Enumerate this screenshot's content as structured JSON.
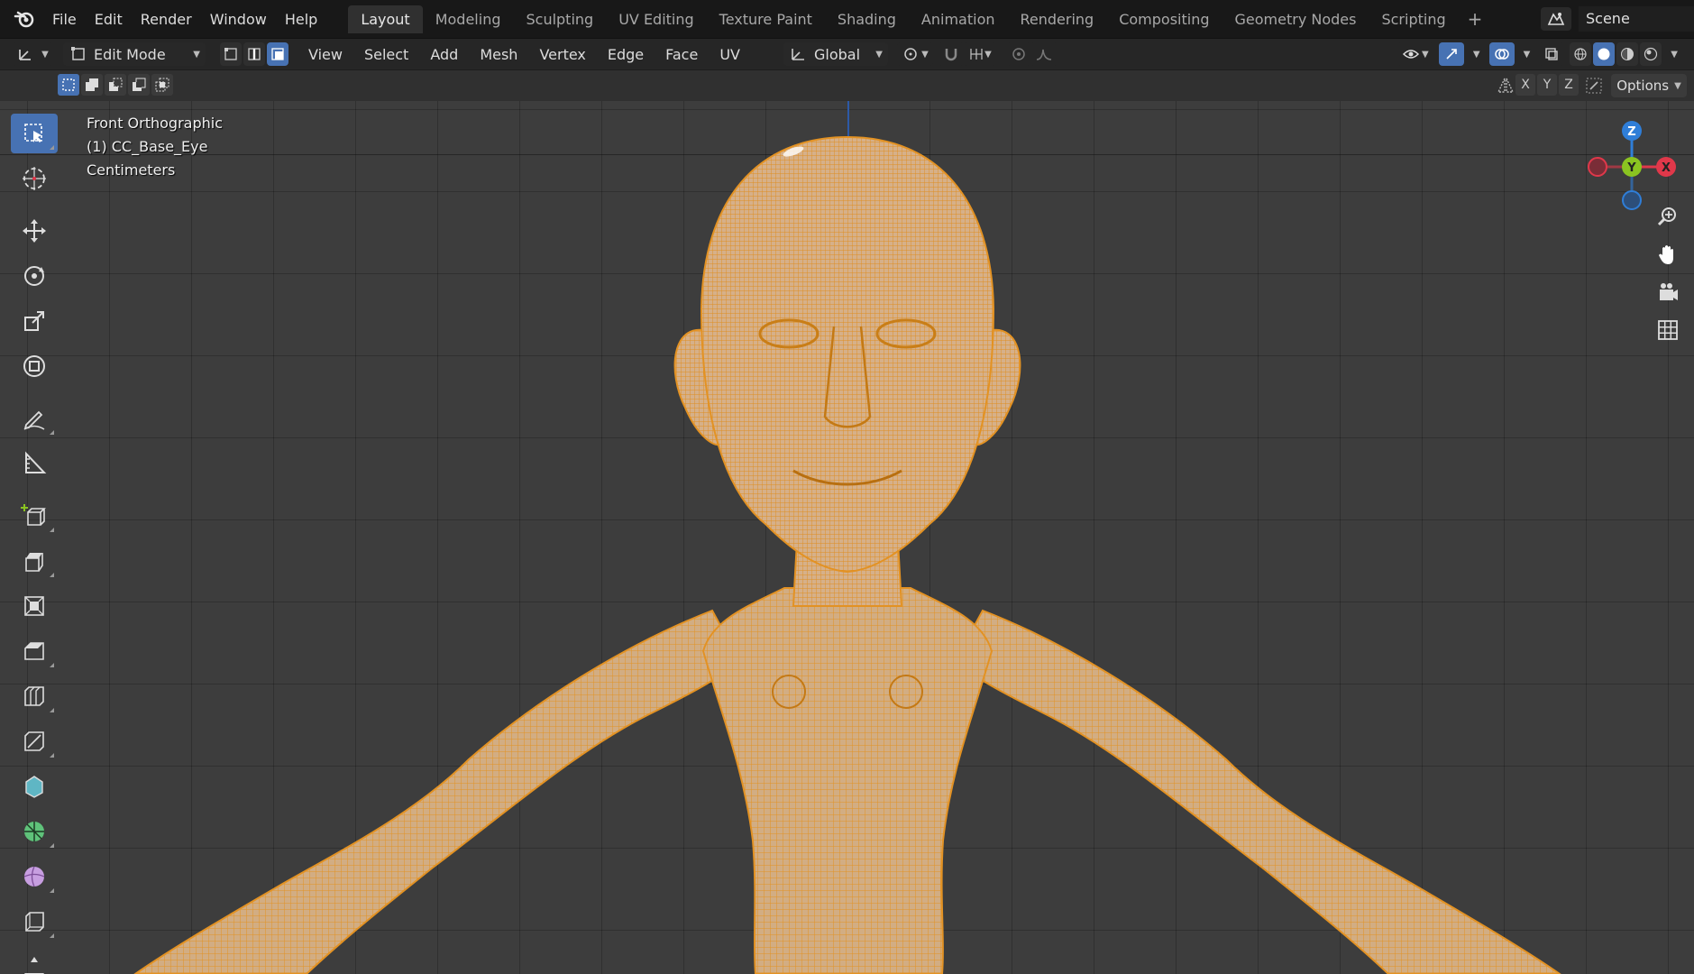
{
  "topbar": {
    "menus": [
      "File",
      "Edit",
      "Render",
      "Window",
      "Help"
    ],
    "workspace_tabs": [
      "Layout",
      "Modeling",
      "Sculpting",
      "UV Editing",
      "Texture Paint",
      "Shading",
      "Animation",
      "Rendering",
      "Compositing",
      "Geometry Nodes",
      "Scripting"
    ],
    "active_tab": "Layout",
    "add_tab": "+",
    "scene_name": "Scene"
  },
  "header": {
    "mode": "Edit Mode",
    "menus": [
      "View",
      "Select",
      "Add",
      "Mesh",
      "Vertex",
      "Edge",
      "Face",
      "UV"
    ],
    "transform_orientation": "Global"
  },
  "tool_settings": {
    "axes": [
      "X",
      "Y",
      "Z"
    ],
    "options_label": "Options"
  },
  "viewport": {
    "view_name": "Front Orthographic",
    "object_name": "(1) CC_Base_Eye",
    "units": "Centimeters"
  },
  "gizmo": {
    "z_label": "Z",
    "y_label": "Y",
    "x_label": "X"
  },
  "colors": {
    "accent": "#4772b3",
    "mesh_face": "#d2ad83",
    "mesh_wire": "#e39223",
    "axis_x": "#e0384a",
    "axis_y": "#8bc421",
    "axis_z": "#2f7ed8"
  }
}
